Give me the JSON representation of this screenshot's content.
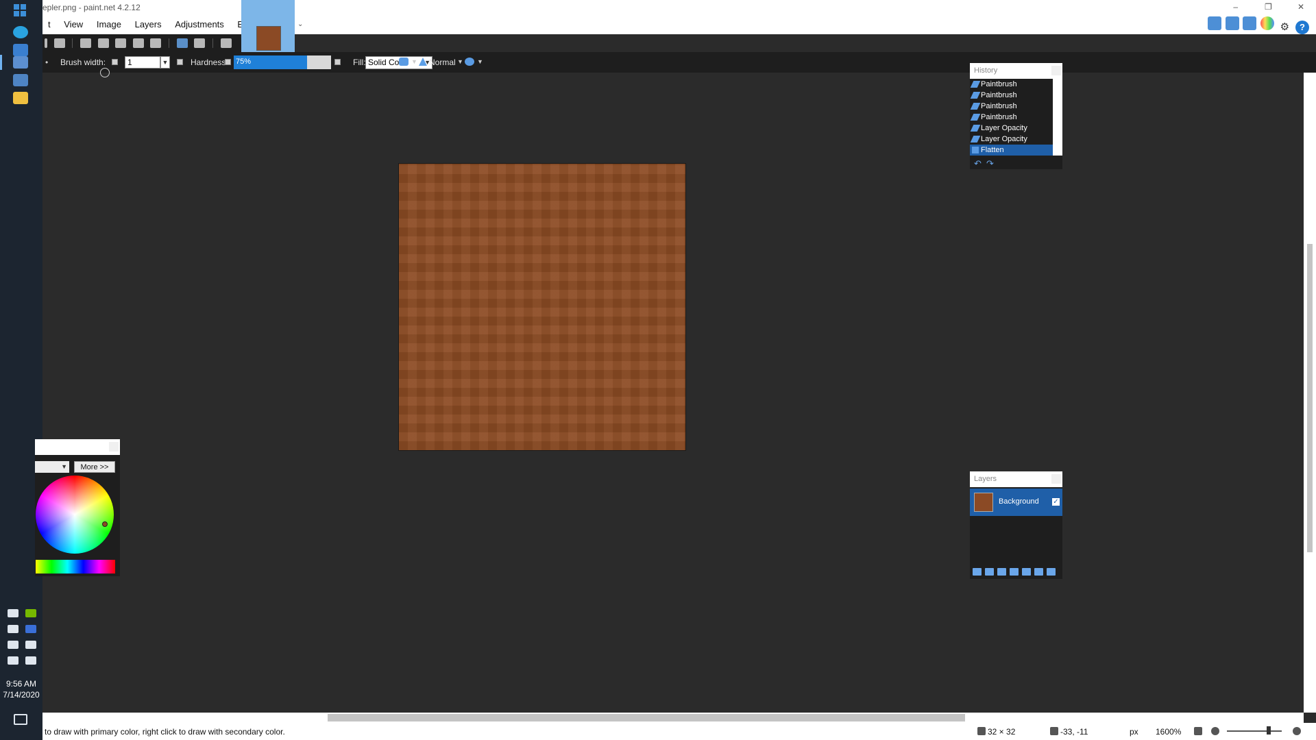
{
  "window": {
    "title": "epler.png - paint.net 4.2.12",
    "controls": [
      "–",
      "❐",
      "✕"
    ]
  },
  "menu": {
    "items": [
      "t",
      "View",
      "Image",
      "Layers",
      "Adjustments",
      "Effects"
    ]
  },
  "tool_options": {
    "brush_width_label": "Brush width:",
    "brush_width_value": "1",
    "hardness_label": "Hardness:",
    "hardness_value": "75%",
    "hardness_fraction": 0.75,
    "fill_label": "Fill:",
    "fill_value": "Solid Color",
    "blend_mode": "Normal"
  },
  "canvas": {
    "fill_color": "#8d4c24"
  },
  "history": {
    "title": "History",
    "items": [
      {
        "label": "Paintbrush",
        "icon": "paintbrush-icon"
      },
      {
        "label": "Paintbrush",
        "icon": "paintbrush-icon"
      },
      {
        "label": "Paintbrush",
        "icon": "paintbrush-icon"
      },
      {
        "label": "Paintbrush",
        "icon": "paintbrush-icon"
      },
      {
        "label": "Layer Opacity",
        "icon": "wrench-icon"
      },
      {
        "label": "Layer Opacity",
        "icon": "wrench-icon"
      },
      {
        "label": "Flatten",
        "icon": "flatten-icon"
      }
    ],
    "selected": "Flatten"
  },
  "layers": {
    "title": "Layers",
    "items": [
      {
        "name": "Background",
        "visible": true
      }
    ]
  },
  "colors": {
    "more_label": "More >>",
    "primary_color": "#8b4a25"
  },
  "taskbar": {
    "time": "9:56 AM",
    "date": "7/14/2020"
  },
  "status": {
    "hint": "to draw with primary color, right click to draw with secondary color.",
    "image_size": "32 × 32",
    "cursor_pos": "-33, -11",
    "unit": "px",
    "zoom": "1600%"
  }
}
